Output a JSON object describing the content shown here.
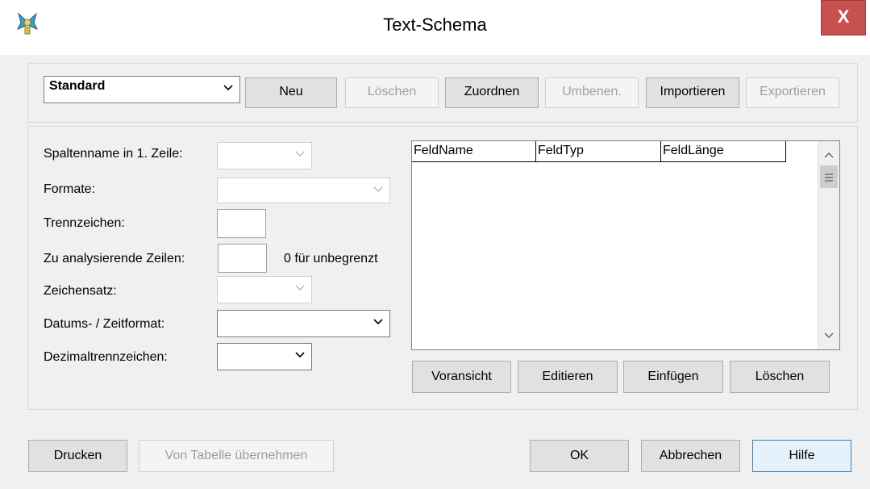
{
  "window": {
    "title": "Text-Schema",
    "close_label": "X"
  },
  "schema": {
    "selected": "Standard",
    "buttons": {
      "new": "Neu",
      "delete": "Löschen",
      "assign": "Zuordnen",
      "rename": "Umbenen.",
      "import": "Importieren",
      "export": "Exportieren"
    }
  },
  "form": {
    "column_names": "Spaltenname in 1. Zeile:",
    "formats": "Formate:",
    "separator": "Trennzeichen:",
    "rows_to_analyze": "Zu analysierende Zeilen:",
    "rows_hint": "0 für unbegrenzt",
    "charset": "Zeichensatz:",
    "datetime_format": "Datums- / Zeitformat:",
    "decimal_separator": "Dezimaltrennzeichen:"
  },
  "fields_table": {
    "columns": [
      "FeldName",
      "FeldTyp",
      "FeldLänge"
    ],
    "rows": []
  },
  "field_buttons": {
    "preview": "Voransicht",
    "edit": "Editieren",
    "insert": "Einfügen",
    "delete": "Löschen"
  },
  "footer": {
    "print": "Drucken",
    "from_table": "Von Tabelle übernehmen",
    "ok": "OK",
    "cancel": "Abbrechen",
    "help": "Hilfe"
  },
  "icons": [
    "app-icon",
    "close-icon",
    "chevron-down-icon",
    "scroll-up-icon",
    "scroll-down-icon",
    "scroll-grip-icon"
  ]
}
